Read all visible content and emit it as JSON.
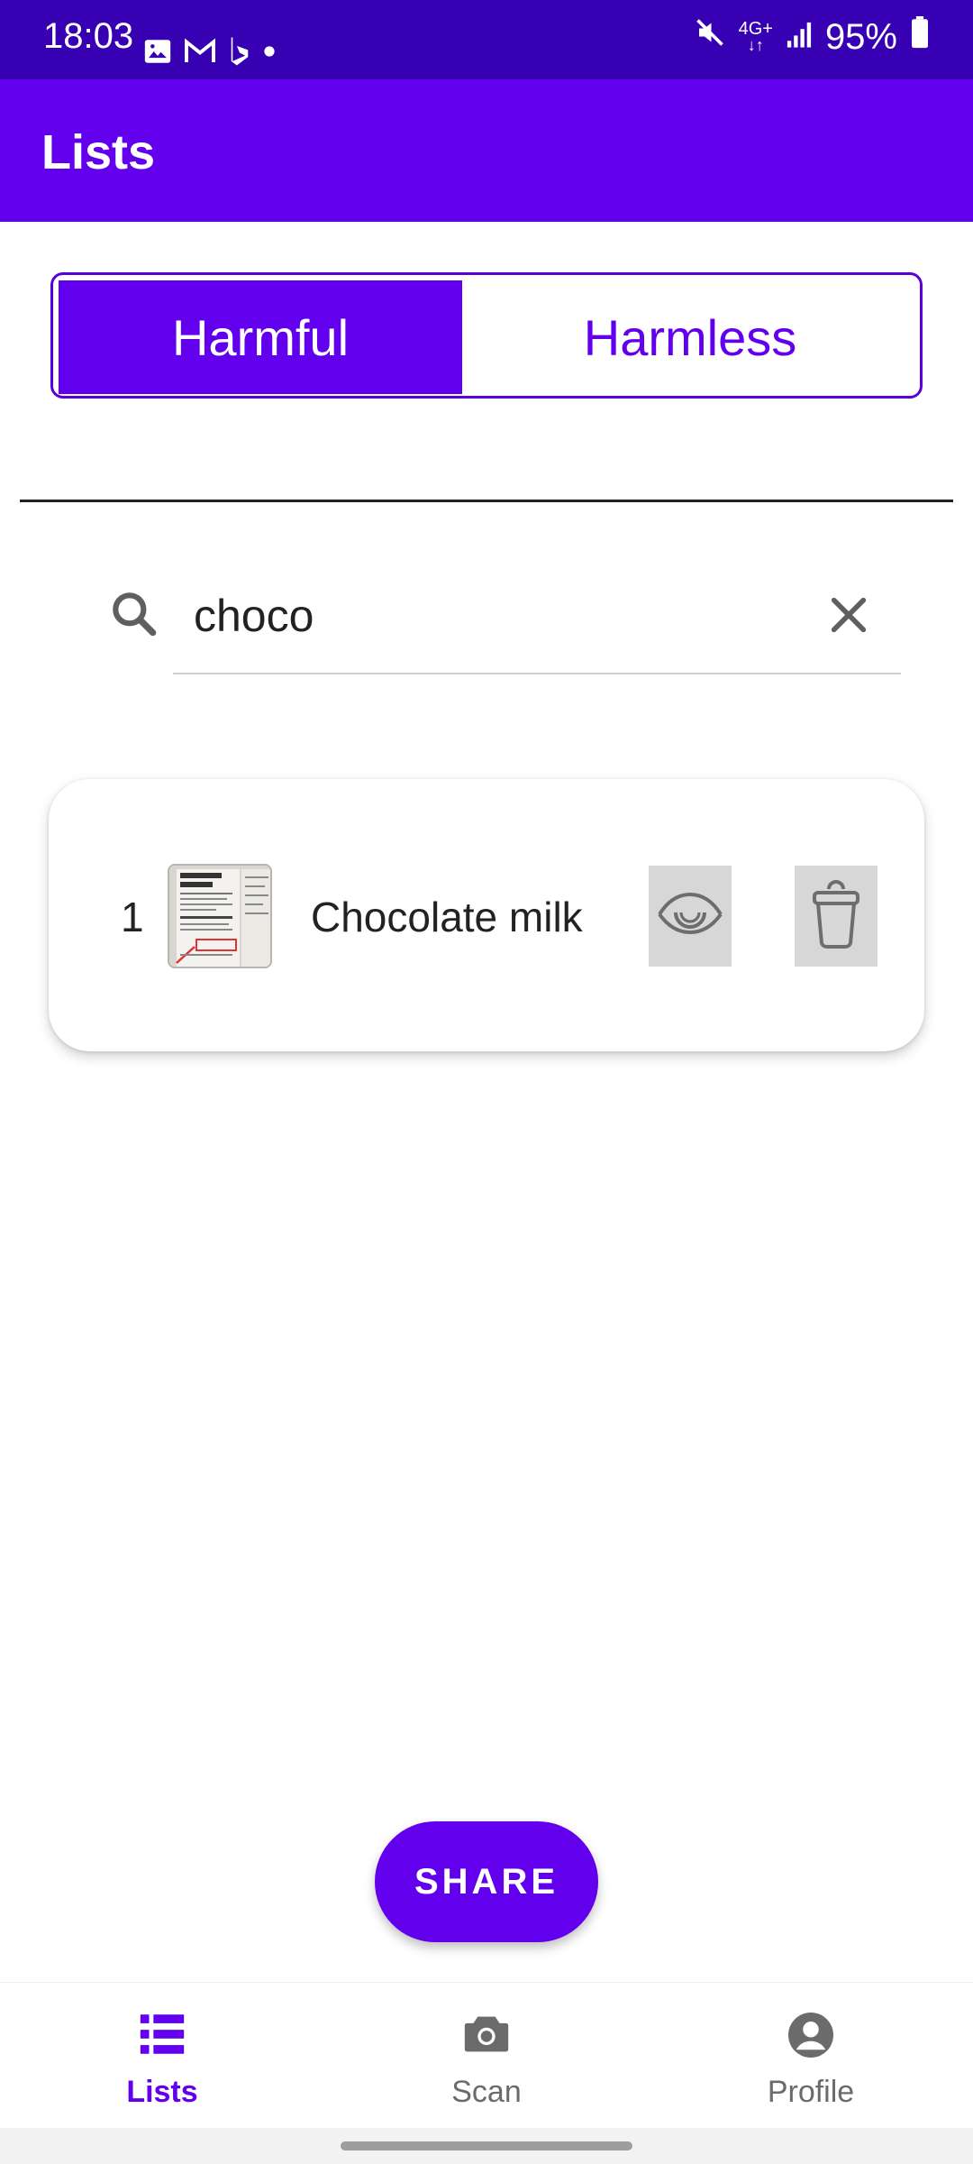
{
  "status_bar": {
    "time": "18:03",
    "network": "4G+",
    "battery": "95%",
    "left_icons": [
      "gallery-icon",
      "gmail-icon",
      "bing-icon",
      "dot-icon"
    ],
    "right_icons": [
      "mute-icon",
      "signal-icon",
      "battery-icon"
    ]
  },
  "app_bar": {
    "title": "Lists"
  },
  "segment": {
    "options": [
      "Harmful",
      "Harmless"
    ],
    "selected": "Harmful",
    "selected_color": "#6200ee"
  },
  "search": {
    "value": "choco",
    "icon": "search-icon",
    "clear_icon": "close-icon"
  },
  "list": {
    "items": [
      {
        "index": "1",
        "name": "Chocolate milk",
        "thumbnail": "nutrition-facts-photo",
        "actions": [
          "eye-icon",
          "trash-icon"
        ]
      }
    ]
  },
  "share_button": {
    "label": "SHARE"
  },
  "bottom_nav": {
    "items": [
      {
        "label": "Lists",
        "icon": "list-icon",
        "active": true
      },
      {
        "label": "Scan",
        "icon": "camera-icon",
        "active": false
      },
      {
        "label": "Profile",
        "icon": "account-icon",
        "active": false
      }
    ]
  },
  "colors": {
    "status_bar": "#3700b3",
    "primary": "#6200ee",
    "nav_inactive": "#6b6b6b"
  }
}
